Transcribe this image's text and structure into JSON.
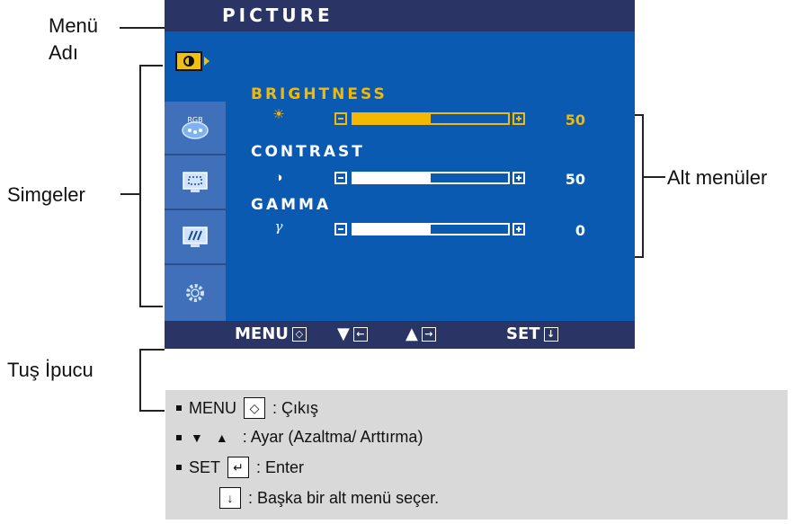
{
  "callouts": {
    "menu_name_line1": "Menü",
    "menu_name_line2": "Adı",
    "icons": "Simgeler",
    "submenus": "Alt menüler",
    "key_hint": "Tuş İpucu"
  },
  "osd": {
    "title": "PICTURE",
    "menu_icons": [
      "picture-icon",
      "rgb-icon",
      "position-icon",
      "tracking-icon",
      "settings-icon"
    ],
    "menu_icon_labels": {
      "rgb": "RGB"
    },
    "submenu": [
      {
        "label": "BRIGHTNESS",
        "symbol": "☀",
        "value": "50",
        "level": 0.5,
        "active": true
      },
      {
        "label": "CONTRAST",
        "symbol": "◑",
        "value": "50",
        "level": 0.5,
        "active": false
      },
      {
        "label": "GAMMA",
        "symbol": "γ",
        "value": "0",
        "level": 0.5,
        "active": false
      }
    ],
    "bottom_bar": {
      "menu_label": "MENU",
      "set_label": "SET"
    },
    "colors": {
      "title_bar": "#2a3566",
      "panel": "#0b5ab2",
      "highlight": "#f5b800"
    }
  },
  "legend": {
    "menu": {
      "key": "MENU",
      "desc": ": Çıkış"
    },
    "adjust": {
      "desc": ": Ayar (Azaltma/ Arttırma)"
    },
    "set": {
      "key": "SET",
      "desc": ": Enter"
    },
    "down": {
      "desc": ": Başka bir alt menü seçer."
    }
  }
}
